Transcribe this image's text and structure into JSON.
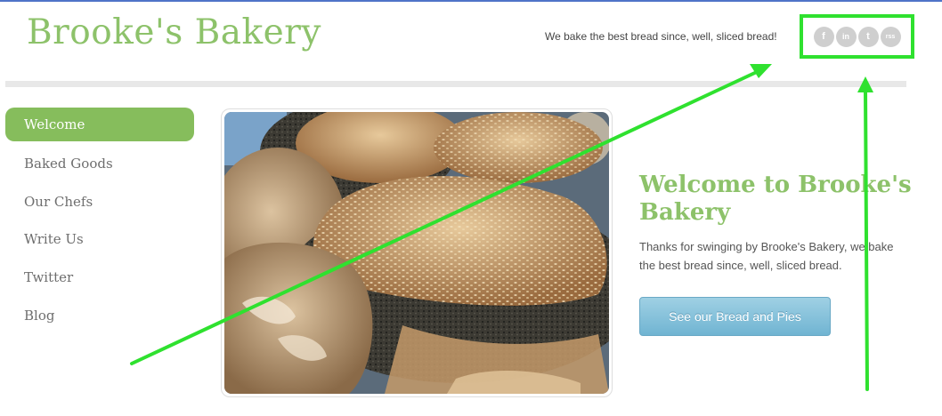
{
  "header": {
    "site_title": "Brooke's Bakery",
    "tagline": "We bake the best bread since, well, sliced bread!"
  },
  "social": [
    {
      "label": "f",
      "icon": "facebook-icon"
    },
    {
      "label": "in",
      "icon": "linkedin-icon"
    },
    {
      "label": "t",
      "icon": "twitter-icon"
    },
    {
      "label": "rss",
      "icon": "rss-icon"
    }
  ],
  "nav": {
    "items": [
      {
        "label": "Welcome",
        "active": true
      },
      {
        "label": "Baked Goods"
      },
      {
        "label": "Our Chefs"
      },
      {
        "label": "Write Us"
      },
      {
        "label": "Twitter"
      },
      {
        "label": "Blog"
      }
    ]
  },
  "main": {
    "hero_image": "bread-photo",
    "welcome_title": "Welcome to Brooke's Bakery",
    "welcome_text": "Thanks for swinging by Brooke's Bakery, we bake the best bread since, well, sliced bread.",
    "cta_label": "See our Bread and Pies"
  },
  "colors": {
    "brand_green": "#8dc26a",
    "nav_active": "#86bd5c",
    "annotation_green": "#2fe12f",
    "cta_blue": "#70b4d2"
  }
}
